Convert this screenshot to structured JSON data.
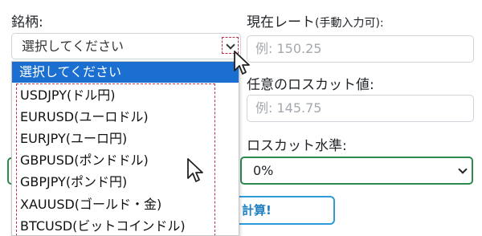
{
  "labels": {
    "symbol": "銘柄:",
    "current_rate": "現在レート",
    "current_rate_note": "(手動入力可):",
    "stop_loss_value": "任意のロスカット値:",
    "stop_loss_level": "ロスカット水準:"
  },
  "symbol_select": {
    "selected": "選択してください",
    "options": [
      "選択してください",
      "USDJPY(ドル円)",
      "EURUSD(ユーロドル)",
      "EURJPY(ユーロ円)",
      "GBPUSD(ポンドドル)",
      "GBPJPY(ポンド円)",
      "XAUUSD(ゴールド・金)",
      "BTCUSD(ビットコインドル)"
    ]
  },
  "current_rate_input": {
    "placeholder": "例: 150.25"
  },
  "stop_loss_input": {
    "placeholder": "例: 145.75"
  },
  "stop_loss_level_select": {
    "selected": "0%"
  },
  "calculate_button": {
    "label": "計算!"
  },
  "colors": {
    "highlight": "#1b6fd1",
    "green_border": "#2c8a4c",
    "button_border": "#2c9ad7",
    "dash_annotation": "#c0344a"
  }
}
